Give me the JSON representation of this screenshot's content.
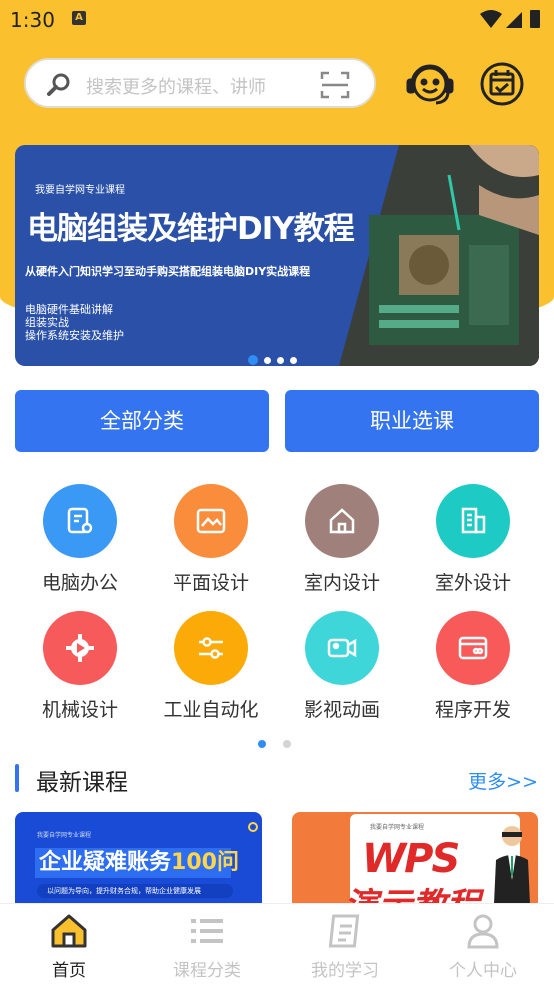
{
  "status_bar": {
    "time": "1:30",
    "notification_icon": "A"
  },
  "search": {
    "placeholder": "搜索更多的课程、讲师"
  },
  "header_icons": [
    "customer-service-icon",
    "calendar-check-icon"
  ],
  "banner": {
    "subtitle": "我要自学网专业课程",
    "title": "电脑组装及维护DIY教程",
    "description": "从硬件入门知识学习至动手购买搭配组装电脑DIY实战课程",
    "bullets": [
      "电脑硬件基础讲解",
      "组装实战",
      "操作系统安装及维护"
    ],
    "slide_count": 4,
    "active_slide": 1
  },
  "buttons": {
    "all_categories": "全部分类",
    "career_courses": "职业选课"
  },
  "categories": [
    {
      "label": "电脑办公",
      "icon": "document-icon",
      "color": "#3a99f5"
    },
    {
      "label": "平面设计",
      "icon": "image-icon",
      "color": "#f98d3c"
    },
    {
      "label": "室内设计",
      "icon": "house-icon",
      "color": "#a0807a"
    },
    {
      "label": "室外设计",
      "icon": "building-icon",
      "color": "#1dcbc4"
    },
    {
      "label": "机械设计",
      "icon": "gear-icon",
      "color": "#f75a5a"
    },
    {
      "label": "工业自动化",
      "icon": "sliders-icon",
      "color": "#fbaa08"
    },
    {
      "label": "影视动画",
      "icon": "video-camera-icon",
      "color": "#3fd6d9"
    },
    {
      "label": "程序开发",
      "icon": "card-icon",
      "color": "#f85a5a"
    }
  ],
  "category_pages": {
    "count": 2,
    "active": 1
  },
  "latest": {
    "title": "最新课程",
    "more": "更多>>",
    "cards": [
      {
        "top": "我要自学网专业课程",
        "title_text": "企业疑难账务",
        "title_num": "100问",
        "subtitle": "以问题为导向，提升财务合规，帮助企业健康发展"
      },
      {
        "top": "我要自学网专业课程",
        "title": "WPS",
        "title2": "演示教程"
      }
    ]
  },
  "tabs": [
    {
      "label": "首页",
      "icon": "home-icon",
      "active": true
    },
    {
      "label": "课程分类",
      "icon": "list-icon",
      "active": false
    },
    {
      "label": "我的学习",
      "icon": "notebook-icon",
      "active": false
    },
    {
      "label": "个人中心",
      "icon": "person-icon",
      "active": false
    }
  ],
  "colors": {
    "header": "#fbc02d",
    "primary": "#3474f0",
    "link": "#2f8df5"
  }
}
